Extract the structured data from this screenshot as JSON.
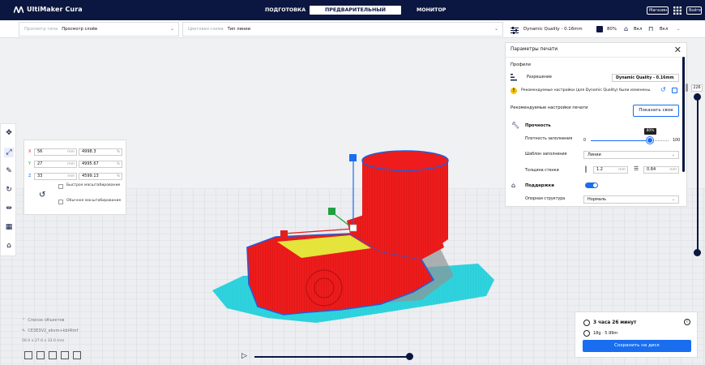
{
  "app": {
    "name": "UltiMaker Cura"
  },
  "stages": [
    {
      "label": "ПОДГОТОВКА",
      "active": false
    },
    {
      "label": "ПРЕДВАРИТЕЛЬНЫЙ ПРОСМОТР",
      "active": true
    },
    {
      "label": "МОНИТОР",
      "active": false
    }
  ],
  "topright": {
    "marketplace": "Магазин",
    "signin": "Войти"
  },
  "viewbar": {
    "view_type_label": "Просмотр типа",
    "view_type_value": "Просмотр слоёв",
    "color_scheme_label": "Цветовая схема",
    "color_scheme_value": "Тип линии",
    "profile": "Dynamic Quality - 0.16mm",
    "infill": "80%",
    "support": "Вкл",
    "adhesion": "Вкл"
  },
  "transform": {
    "x": "56",
    "y": "27",
    "z": "33",
    "x_pct": "4998.3",
    "y_pct": "4995.67",
    "z_pct": "4599.13",
    "unit": "mm",
    "pct": "%",
    "axes": [
      "X",
      "Y",
      "Z"
    ],
    "snap_label": "Быстрое масштабирование",
    "uniform_label": "Обычное масштабирование"
  },
  "settings": {
    "title": "Параметры печати",
    "profiles": "Профили",
    "resolution_label": "Разрешение",
    "resolution_value": "Dynamic Quality - 0.16mm",
    "warning": "Рекомендуемые настройки (для Dynamic Quality) были изменены.",
    "recommended": "Рекомендуемые настройки печати",
    "show_custom": "Показать свое",
    "strength": "Прочность",
    "infill_density_label": "Плотность заполнения",
    "infill_min": "0",
    "infill_max": "100",
    "infill_tooltip": "80%",
    "infill_value": 80,
    "pattern_label": "Шаблон заполнения",
    "pattern_value": "Линии",
    "wall_label": "Толщина стенки",
    "wall_value": "1.2",
    "top_value": "0.84",
    "unit": "mm",
    "support": "Поддержки",
    "support_structure_label": "Опорная структура",
    "support_structure_value": "Нормаль"
  },
  "layer": {
    "value": "226"
  },
  "objects": {
    "title": "Список объектов",
    "file": "CE3E3V2_ekvm+kbl4lmf",
    "dims": "56.0 x 27.0 x 33.0 mm"
  },
  "print": {
    "time": "3 часа 26 минут",
    "material": "18g · 5.99m",
    "save": "Сохранить на диск"
  },
  "colors": {
    "accent": "#196ef0",
    "brand": "#0b1740",
    "model": "#ee1c1c",
    "support": "#30d6e0"
  }
}
